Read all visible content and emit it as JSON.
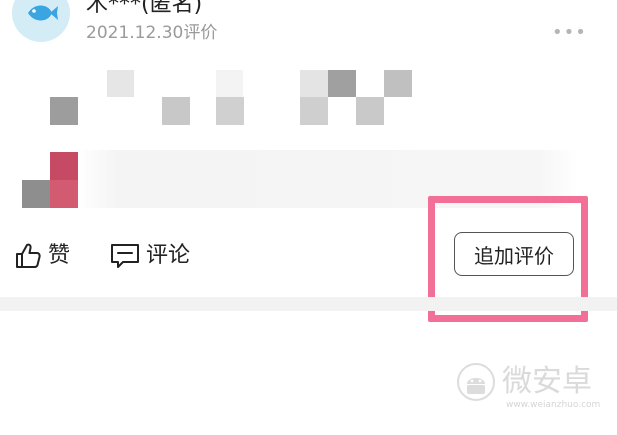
{
  "review": {
    "username": "木***(匿名)",
    "date": "2021.12.30评价",
    "more_label": "•••"
  },
  "actions": {
    "like_label": "赞",
    "comment_label": "评论",
    "follow_up_label": "追加评价"
  },
  "watermark": {
    "brand": "微安卓",
    "url": "www.weianzhuo.com"
  },
  "colors": {
    "highlight": "#f26f98",
    "avatar_bg": "#d4ecf6",
    "fish_icon": "#3aa5e0"
  }
}
